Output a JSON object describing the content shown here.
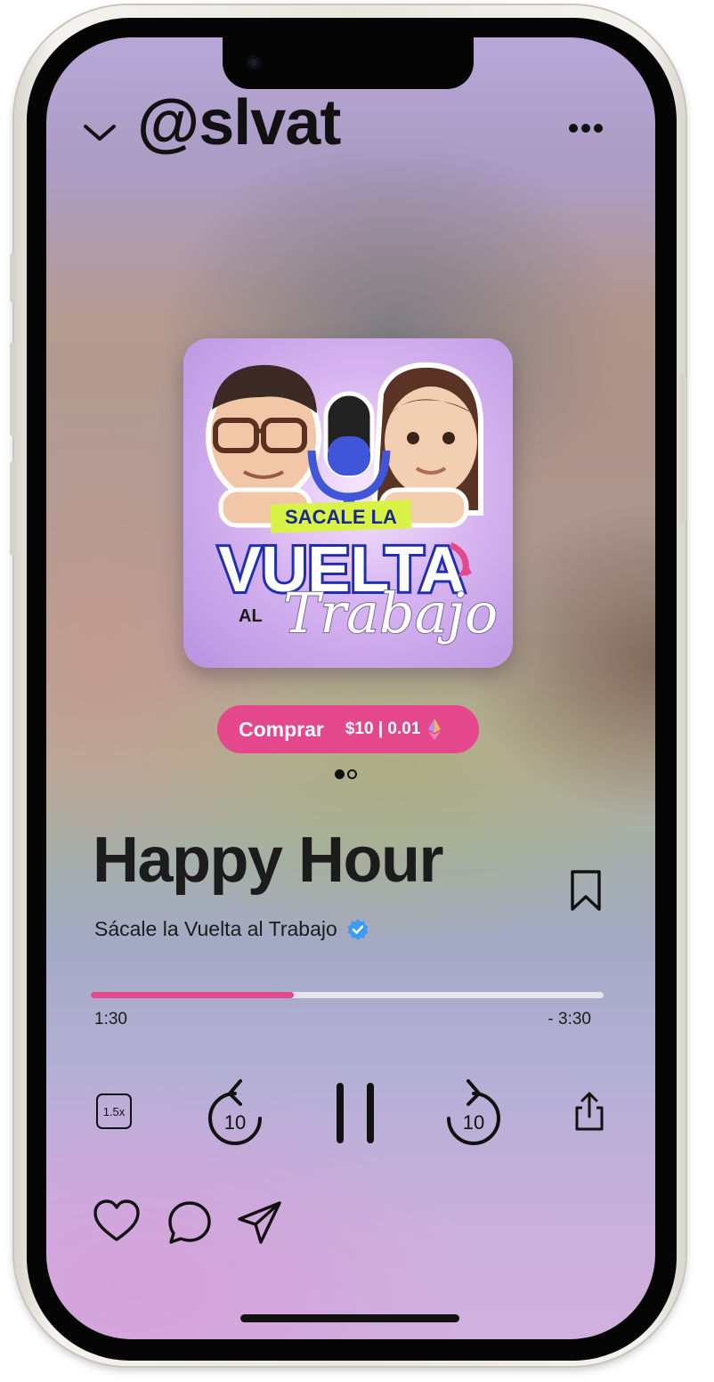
{
  "header": {
    "handle": "@slvat"
  },
  "cover": {
    "title_top": "SACALE LA",
    "title_main": "VUELTA",
    "title_al": "AL",
    "title_script": "Trabajo"
  },
  "buy": {
    "label": "Comprar",
    "price": "$10 | 0.01"
  },
  "pager": {
    "total": 2,
    "active": 0
  },
  "track": {
    "title": "Happy Hour",
    "artist": "Sácale la Vuelta al Trabajo",
    "verified": true
  },
  "progress": {
    "fraction": 0.395,
    "elapsed": "1:30",
    "remaining": "- 3:30"
  },
  "controls": {
    "speed": "1.5x",
    "skip_back": "10",
    "skip_forward": "10"
  },
  "colors": {
    "accent": "#e5478d",
    "verified": "#3b9cf2"
  },
  "icons": [
    "chevron-down-icon",
    "more-icon",
    "ethereum-icon",
    "verified-icon",
    "bookmark-icon",
    "rewind-10-icon",
    "pause-icon",
    "forward-10-icon",
    "share-icon",
    "heart-icon",
    "comment-icon",
    "send-icon"
  ]
}
